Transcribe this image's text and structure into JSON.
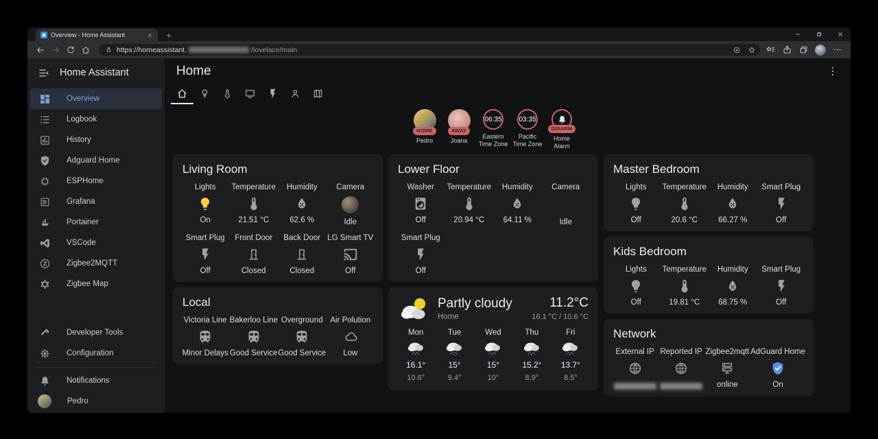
{
  "browser": {
    "tab": {
      "title": "Overview - Home Assistant"
    },
    "url": {
      "scheme_host": "https://homeassistant.",
      "redacted": true,
      "path": "/lovelace/main"
    }
  },
  "sidebar": {
    "title": "Home Assistant",
    "items": [
      {
        "icon": "dashboard",
        "label": "Overview",
        "active": true
      },
      {
        "icon": "list",
        "label": "Logbook"
      },
      {
        "icon": "chartbox",
        "label": "History"
      },
      {
        "icon": "shield",
        "label": "Adguard Home"
      },
      {
        "icon": "chip",
        "label": "ESPHome"
      },
      {
        "icon": "grafana",
        "label": "Grafana"
      },
      {
        "icon": "portainer",
        "label": "Portainer"
      },
      {
        "icon": "vscode",
        "label": "VSCode"
      },
      {
        "icon": "zcircle",
        "label": "Zigbee2MQTT"
      },
      {
        "icon": "hexagram",
        "label": "Zigbee Map"
      }
    ],
    "tools": [
      {
        "icon": "hammer",
        "label": "Developer Tools"
      },
      {
        "icon": "gear",
        "label": "Configuration"
      }
    ],
    "bottom": [
      {
        "icon": "bell",
        "label": "Notifications"
      },
      {
        "icon": "avatar",
        "label": "Pedro"
      }
    ]
  },
  "header": {
    "title": "Home"
  },
  "view_tabs": [
    {
      "icon": "home",
      "active": true
    },
    {
      "icon": "bulb-outline"
    },
    {
      "icon": "thermo-outline"
    },
    {
      "icon": "tv"
    },
    {
      "icon": "flash"
    },
    {
      "icon": "person"
    },
    {
      "icon": "map"
    }
  ],
  "badges": [
    {
      "type": "avatar",
      "avatar": "pedro",
      "label": "HOME",
      "name": "Pedro"
    },
    {
      "type": "avatar",
      "avatar": "joana",
      "label": "AWAY",
      "name": "Joana"
    },
    {
      "type": "value",
      "value": "06:35",
      "name": "Eastern Time Zone"
    },
    {
      "type": "value",
      "value": "03:35",
      "name": "Pacific Time Zone"
    },
    {
      "type": "icon",
      "icon": "bell",
      "label": "DISARM",
      "name": "Home Alarm"
    }
  ],
  "cards": {
    "living_room": {
      "title": "Living Room",
      "items": [
        {
          "label": "Lights",
          "icon": "bulb",
          "on": true,
          "state": "On"
        },
        {
          "label": "Temperature",
          "icon": "thermo",
          "state": "21.51 °C"
        },
        {
          "label": "Humidity",
          "icon": "droplet",
          "state": "62.6 %"
        },
        {
          "label": "Camera",
          "icon": "camera-living",
          "state": "Idle"
        },
        {
          "label": "Smart Plug",
          "icon": "flash",
          "state": "Off"
        },
        {
          "label": "Front Door",
          "icon": "door",
          "state": "Closed"
        },
        {
          "label": "Back Door",
          "icon": "door",
          "state": "Closed"
        },
        {
          "label": "LG Smart TV",
          "icon": "cast",
          "state": "Off"
        }
      ]
    },
    "lower_floor": {
      "title": "Lower Floor",
      "items": [
        {
          "label": "Washer",
          "icon": "washer",
          "state": "Off"
        },
        {
          "label": "Temperature",
          "icon": "thermo",
          "state": "20.94 °C"
        },
        {
          "label": "Humidity",
          "icon": "droplet",
          "state": "64.11 %"
        },
        {
          "label": "Camera",
          "icon": "camera-lower",
          "state": "Idle"
        },
        {
          "label": "Smart Plug",
          "icon": "flash",
          "state": "Off"
        }
      ]
    },
    "master_bedroom": {
      "title": "Master Bedroom",
      "items": [
        {
          "label": "Lights",
          "icon": "bulb",
          "state": "Off"
        },
        {
          "label": "Temperature",
          "icon": "thermo",
          "state": "20.6 °C"
        },
        {
          "label": "Humidity",
          "icon": "droplet",
          "state": "66.27 %"
        },
        {
          "label": "Smart Plug",
          "icon": "flash",
          "state": "Off"
        }
      ]
    },
    "kids_bedroom": {
      "title": "Kids Bedroom",
      "items": [
        {
          "label": "Lights",
          "icon": "bulb",
          "state": "Off"
        },
        {
          "label": "Temperature",
          "icon": "thermo",
          "state": "19.81 °C"
        },
        {
          "label": "Humidity",
          "icon": "droplet",
          "state": "68.75 %"
        },
        {
          "label": "Smart Plug",
          "icon": "flash",
          "state": "Off"
        }
      ]
    },
    "local": {
      "title": "Local",
      "items": [
        {
          "label": "Victoria Line",
          "icon": "train",
          "state": "Minor Delays"
        },
        {
          "label": "Bakerloo Line",
          "icon": "train",
          "state": "Good Service"
        },
        {
          "label": "Overground",
          "icon": "train",
          "state": "Good Service"
        },
        {
          "label": "Air Polution",
          "icon": "cloud",
          "state": "Low"
        }
      ]
    },
    "network": {
      "title": "Network",
      "items": [
        {
          "label": "External IP",
          "icon": "globe",
          "state": "",
          "redacted": true
        },
        {
          "label": "Reported IP",
          "icon": "globe",
          "state": "",
          "redacted": true
        },
        {
          "label": "Zigbee2mqtt",
          "icon": "server",
          "state": "online"
        },
        {
          "label": "AdGuard Home",
          "icon": "shieldblue",
          "state": "On"
        }
      ]
    }
  },
  "weather": {
    "condition": "Partly cloudy",
    "location": "Home",
    "temperature": "11.2°C",
    "high_low": "16.1 °C / 10.6 °C",
    "forecast": [
      {
        "day": "Mon",
        "high": "16.1°",
        "low": "10.6°"
      },
      {
        "day": "Tue",
        "high": "15°",
        "low": "9.4°"
      },
      {
        "day": "Wed",
        "high": "15°",
        "low": "10°"
      },
      {
        "day": "Thu",
        "high": "15.2°",
        "low": "8.9°"
      },
      {
        "day": "Fri",
        "high": "13.7°",
        "low": "8.5°"
      }
    ]
  },
  "colors": {
    "accent": "#7da2e0",
    "badge": "#c96464",
    "bulb_on": "#ffce44",
    "shield_on": "#5b8de1"
  }
}
